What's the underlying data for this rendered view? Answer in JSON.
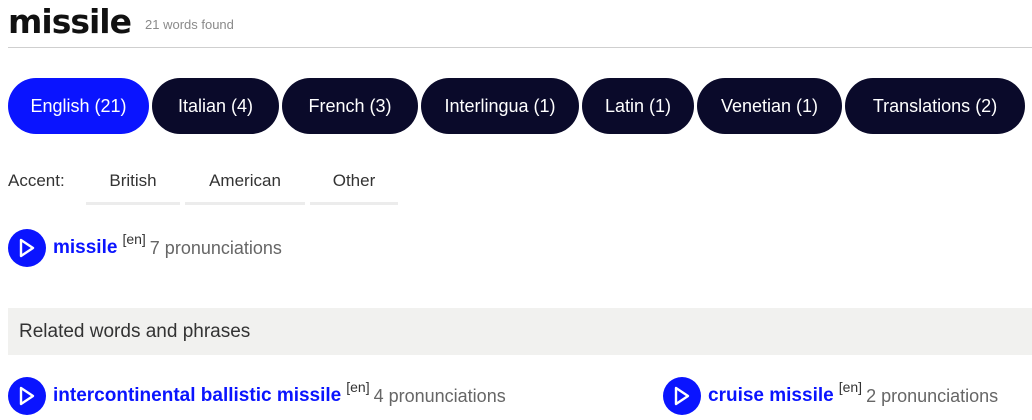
{
  "header": {
    "title": "missile",
    "count_text": "21 words found"
  },
  "tabs": [
    {
      "label": "English (21)",
      "active": true
    },
    {
      "label": "Italian (4)",
      "active": false
    },
    {
      "label": "French (3)",
      "active": false
    },
    {
      "label": "Interlingua (1)",
      "active": false
    },
    {
      "label": "Latin (1)",
      "active": false
    },
    {
      "label": "Venetian (1)",
      "active": false
    },
    {
      "label": "Translations (2)",
      "active": false
    }
  ],
  "accent": {
    "label": "Accent:",
    "options": [
      "British",
      "American",
      "Other"
    ]
  },
  "main_word": {
    "icon": "play-icon",
    "word": "missile",
    "lang": "[en]",
    "pronunciations": "7 pronunciations"
  },
  "related": {
    "heading": "Related words and phrases",
    "items": [
      {
        "icon": "play-icon",
        "word": "intercontinental ballistic missile",
        "lang": "[en]",
        "pronunciations": "4 pronunciations"
      },
      {
        "icon": "play-icon",
        "word": "cruise missile",
        "lang": "[en]",
        "pronunciations": "2 pronunciations"
      }
    ]
  },
  "colors": {
    "accent_blue": "#0a14ff",
    "tab_dark": "#0a0a2a",
    "section_bg": "#f1f1ef"
  }
}
